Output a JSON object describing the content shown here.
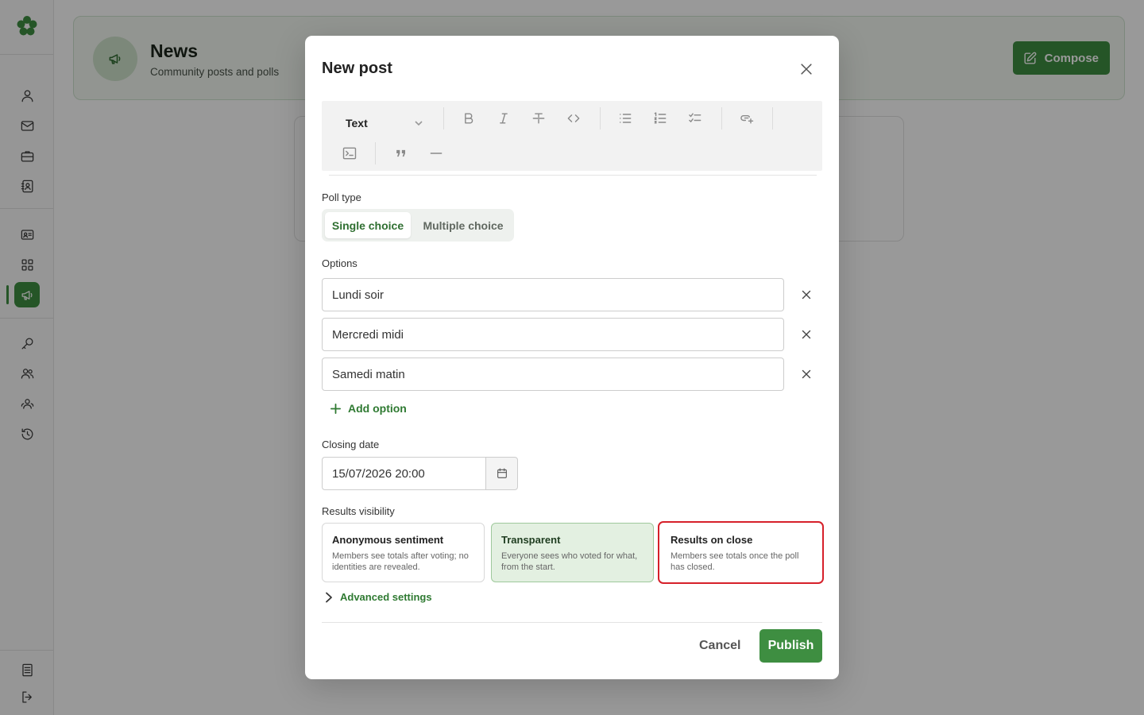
{
  "colors": {
    "accent": "#3e8e41",
    "highlight": "#d6202a",
    "selected_bg": "#e3f0e1"
  },
  "sidebar": {
    "items": [
      {
        "name": "user-icon"
      },
      {
        "name": "mail-icon"
      },
      {
        "name": "briefcase-icon"
      },
      {
        "name": "contact-book-icon"
      },
      {
        "name": "id-card-icon"
      },
      {
        "name": "apps-grid-icon"
      },
      {
        "name": "megaphone-icon",
        "active": true
      },
      {
        "name": "key-icon"
      },
      {
        "name": "group-icon"
      },
      {
        "name": "team-icon"
      },
      {
        "name": "history-icon"
      },
      {
        "name": "notes-icon"
      },
      {
        "name": "logout-icon"
      }
    ]
  },
  "page": {
    "title": "News",
    "subtitle": "Community posts and polls",
    "compose_label": "Compose"
  },
  "modal": {
    "title": "New post",
    "toolbar": {
      "text_style": "Text"
    },
    "poll_type": {
      "label": "Poll type",
      "options": [
        "Single choice",
        "Multiple choice"
      ],
      "selected": "Single choice"
    },
    "options": {
      "label": "Options",
      "items": [
        "Lundi soir",
        "Mercredi midi",
        "Samedi matin"
      ],
      "add_label": "Add option"
    },
    "closing_date": {
      "label": "Closing date",
      "value": "15/07/2026 20:00"
    },
    "results_visibility": {
      "label": "Results visibility",
      "selected": "Transparent",
      "cards": [
        {
          "title": "Anonymous sentiment",
          "desc": "Members see totals after voting; no identities are revealed."
        },
        {
          "title": "Transparent",
          "desc": "Everyone sees who voted for what, from the start."
        },
        {
          "title": "Results on close",
          "desc": "Members see totals once the poll has closed."
        }
      ]
    },
    "advanced_label": "Advanced settings",
    "cancel_label": "Cancel",
    "publish_label": "Publish"
  }
}
